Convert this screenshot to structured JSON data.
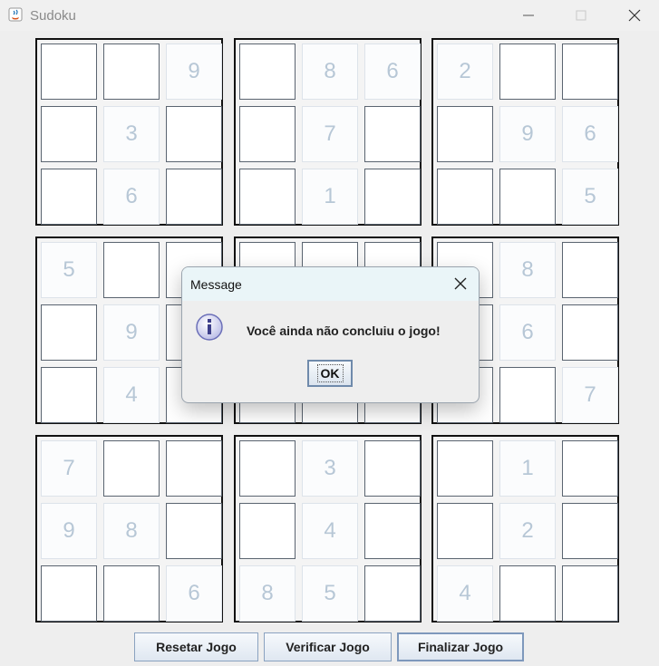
{
  "window": {
    "title": "Sudoku"
  },
  "board": {
    "blocks": [
      {
        "cells": [
          "",
          "",
          "9",
          "",
          "3",
          "",
          "",
          "6",
          ""
        ]
      },
      {
        "cells": [
          "",
          "8",
          "6",
          "",
          "7",
          "",
          "",
          "1",
          ""
        ]
      },
      {
        "cells": [
          "2",
          "",
          "",
          "",
          "9",
          "6",
          "",
          "",
          "5"
        ]
      },
      {
        "cells": [
          "5",
          "",
          "",
          "",
          "9",
          "",
          "",
          "4",
          ""
        ]
      },
      {
        "cells": [
          "",
          "",
          "",
          "",
          "",
          "",
          "",
          "",
          ""
        ]
      },
      {
        "cells": [
          "",
          "8",
          "",
          "",
          "6",
          "",
          "",
          "",
          "7"
        ]
      },
      {
        "cells": [
          "7",
          "",
          "",
          "9",
          "8",
          "",
          "",
          "",
          "6"
        ]
      },
      {
        "cells": [
          "",
          "3",
          "",
          "",
          "4",
          "",
          "8",
          "5",
          ""
        ]
      },
      {
        "cells": [
          "",
          "1",
          "",
          "",
          "2",
          "",
          "4",
          "",
          ""
        ]
      }
    ]
  },
  "buttons": {
    "reset": "Resetar Jogo",
    "verify": "Verificar Jogo",
    "finish": "Finalizar Jogo"
  },
  "dialog": {
    "title": "Message",
    "message": "Você ainda não concluiu o jogo!",
    "ok": "OK"
  }
}
